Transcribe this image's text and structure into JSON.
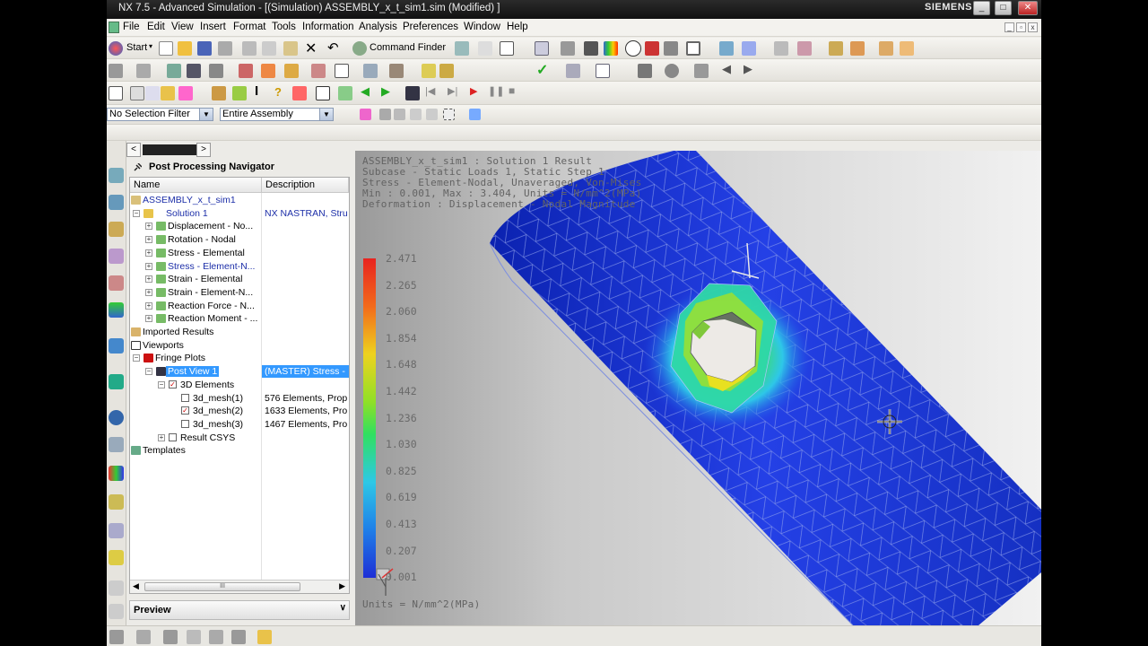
{
  "window": {
    "title": "NX 7.5 - Advanced Simulation - [(Simulation) ASSEMBLY_x_t_sim1.sim (Modified) ]",
    "brand": "SIEMENS"
  },
  "menu": [
    "File",
    "Edit",
    "View",
    "Insert",
    "Format",
    "Tools",
    "Information",
    "Analysis",
    "Preferences",
    "Window",
    "Help"
  ],
  "toolbar": {
    "start_label": "Start",
    "command_finder_label": "Command Finder",
    "selection_filter": "No Selection Filter",
    "assembly_scope": "Entire Assembly"
  },
  "navigator": {
    "title": "Post Processing Navigator",
    "columns": [
      "Name",
      "Description"
    ],
    "rows": [
      {
        "name": "ASSEMBLY_x_t_sim1",
        "desc": ""
      },
      {
        "name": "Solution 1",
        "desc": "NX NASTRAN, Stru"
      },
      {
        "name": "Displacement - No...",
        "desc": ""
      },
      {
        "name": "Rotation - Nodal",
        "desc": ""
      },
      {
        "name": "Stress - Elemental",
        "desc": ""
      },
      {
        "name": "Stress - Element-N...",
        "desc": ""
      },
      {
        "name": "Strain - Elemental",
        "desc": ""
      },
      {
        "name": "Strain - Element-N...",
        "desc": ""
      },
      {
        "name": "Reaction Force - N...",
        "desc": ""
      },
      {
        "name": "Reaction Moment - ...",
        "desc": ""
      },
      {
        "name": "Imported Results",
        "desc": ""
      },
      {
        "name": "Viewports",
        "desc": ""
      },
      {
        "name": "Fringe Plots",
        "desc": ""
      },
      {
        "name": "Post View 1",
        "desc": "(MASTER) Stress -"
      },
      {
        "name": "3D Elements",
        "desc": ""
      },
      {
        "name": "3d_mesh(1)",
        "desc": "576 Elements, Prop"
      },
      {
        "name": "3d_mesh(2)",
        "desc": "1633 Elements, Pro"
      },
      {
        "name": "3d_mesh(3)",
        "desc": "1467 Elements, Pro"
      },
      {
        "name": "Result CSYS",
        "desc": ""
      },
      {
        "name": "Templates",
        "desc": ""
      }
    ],
    "scroll_grip": "III",
    "preview_label": "Preview"
  },
  "viewport": {
    "header_lines": [
      "ASSEMBLY_x_t_sim1 : Solution 1 Result",
      "Subcase - Static Loads 1, Static Step 1",
      "Stress - Element-Nodal, Unaveraged, Von-Mises",
      "Min : 0.001, Max : 3.404, Units = N/mm^2(MPa)",
      "Deformation : Displacement - Nodal Magnitude"
    ],
    "legend_values": [
      "2.471",
      "2.265",
      "2.060",
      "1.854",
      "1.648",
      "1.442",
      "1.236",
      "1.030",
      "0.825",
      "0.619",
      "0.413",
      "0.207",
      "0.001"
    ],
    "units_label": "Units = N/mm^2(MPa)",
    "colors": {
      "max": "#e8231f",
      "mid": "#3fe05a",
      "min": "#1e2fd6",
      "tube": "#1b34d8"
    }
  },
  "icons": [
    "start-icon",
    "new-icon",
    "open-icon",
    "save-icon",
    "print-icon",
    "cut-icon",
    "copy-icon",
    "paste-icon",
    "delete-icon",
    "undo-icon",
    "command-finder-icon",
    "fit-icon",
    "shaded-icon",
    "animation-play-icon",
    "animation-stop-icon"
  ]
}
